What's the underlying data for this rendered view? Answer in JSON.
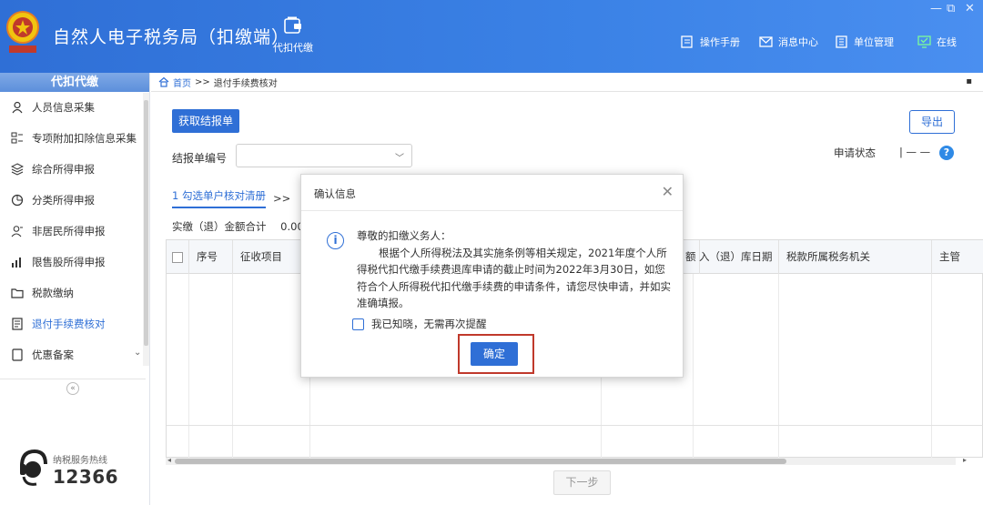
{
  "header": {
    "app_title": "自然人电子税务局（扣缴端）",
    "tab_label": "代扣代缴",
    "links": {
      "manual": "操作手册",
      "messages": "消息中心",
      "unit": "单位管理",
      "online": "在线"
    },
    "window_controls": {
      "minimize": "—",
      "restore": "⧉"
    }
  },
  "sidebar": {
    "title": "代扣代缴",
    "items": [
      {
        "label": "人员信息采集",
        "icon": "person-icon"
      },
      {
        "label": "专项附加扣除信息采集",
        "icon": "grid-icon"
      },
      {
        "label": "综合所得申报",
        "icon": "layers-icon"
      },
      {
        "label": "分类所得申报",
        "icon": "pie-icon"
      },
      {
        "label": "非居民所得申报",
        "icon": "person-outline-icon"
      },
      {
        "label": "限售股所得申报",
        "icon": "bar-chart-icon"
      },
      {
        "label": "税款缴纳",
        "icon": "folder-icon"
      },
      {
        "label": "退付手续费核对",
        "icon": "document-icon"
      },
      {
        "label": "优惠备案",
        "icon": "file-icon"
      }
    ],
    "collapse_glyph": "«",
    "hotline_label": "纳税服务热线",
    "hotline_number": "12366"
  },
  "breadcrumb": {
    "home": "首页",
    "sep": ">>",
    "current": "退付手续费核对"
  },
  "main": {
    "fetch_button": "获取结报单",
    "export_button": "导出",
    "field_label": "结报单编号",
    "status_label": "申请状态",
    "status_value": "|  — —",
    "steps": {
      "step1": "1 勾选单户核对清册",
      "sep": ">>"
    },
    "amount_label": "实缴（退）金额合计",
    "amount_value": "0.00",
    "next_button": "下一步"
  },
  "table": {
    "columns": [
      "序号",
      "征收项目",
      "额",
      "入（退）库日期",
      "税款所属税务机关",
      "主管"
    ]
  },
  "modal": {
    "title": "确认信息",
    "greeting": "尊敬的扣缴义务人：",
    "body": "根据个人所得税法及其实施条例等相关规定，2021年度个人所得税代扣代缴手续费退库申请的截止时间为2022年3月30日，如您符合个人所得税代扣代缴手续费的申请条件，请您尽快申请，并如实准确填报。",
    "checkbox_label": "我已知晓，无需再次提醒",
    "confirm_button": "确定"
  },
  "colors": {
    "primary": "#2f6fd6",
    "highlight": "#c0392b"
  }
}
